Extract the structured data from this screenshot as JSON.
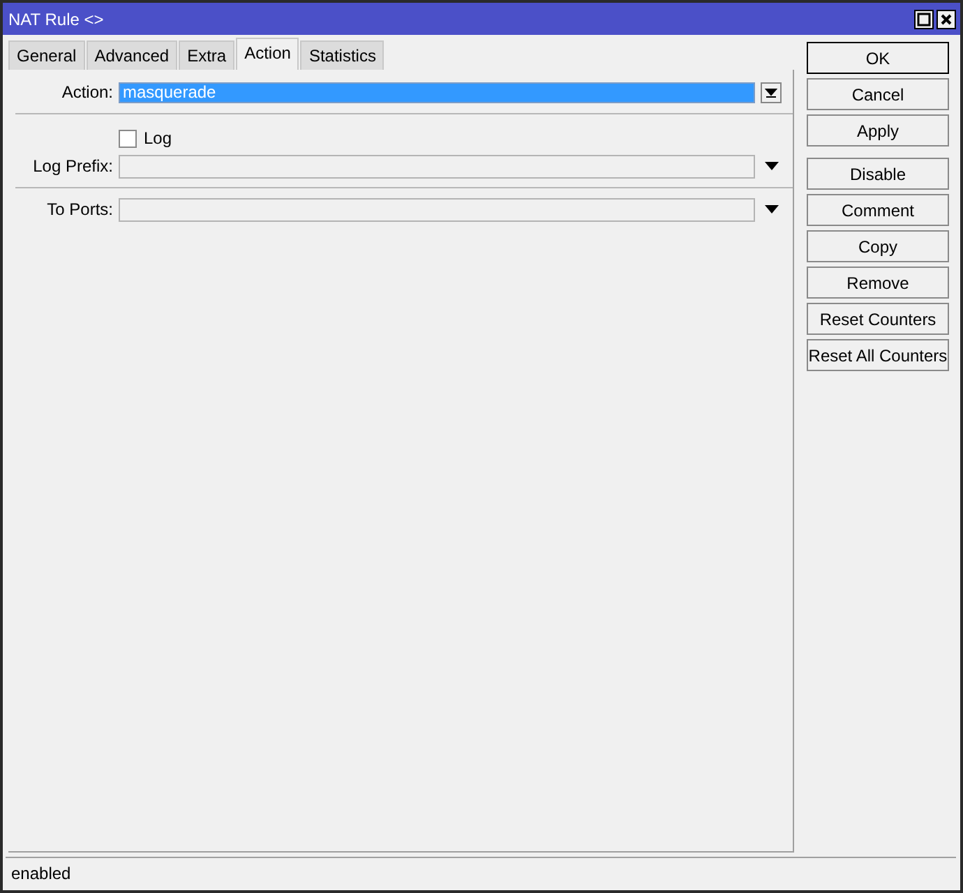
{
  "window": {
    "title": "NAT Rule <>"
  },
  "tabs": [
    {
      "label": "General",
      "selected": false
    },
    {
      "label": "Advanced",
      "selected": false
    },
    {
      "label": "Extra",
      "selected": false
    },
    {
      "label": "Action",
      "selected": true
    },
    {
      "label": "Statistics",
      "selected": false
    }
  ],
  "fields": [
    {
      "kind": "select",
      "label": "Action:",
      "value": "masquerade"
    },
    {
      "kind": "divider"
    },
    {
      "kind": "checkbox",
      "label": "Log",
      "checked": false
    },
    {
      "kind": "combo",
      "label": "Log Prefix:"
    },
    {
      "kind": "divider"
    },
    {
      "kind": "combo",
      "label": "To Ports:"
    }
  ],
  "button_groups": [
    {
      "buttons": [
        {
          "label": "OK",
          "default": true
        },
        {
          "label": "Cancel",
          "default": false
        },
        {
          "label": "Apply",
          "default": false
        }
      ]
    },
    {
      "buttons": [
        {
          "label": "Disable",
          "default": false
        },
        {
          "label": "Comment",
          "default": false
        },
        {
          "label": "Copy",
          "default": false
        },
        {
          "label": "Remove",
          "default": false
        },
        {
          "label": "Reset Counters",
          "default": false
        },
        {
          "label": "Reset All Counters",
          "default": false
        }
      ]
    }
  ],
  "status_bar": "enabled"
}
